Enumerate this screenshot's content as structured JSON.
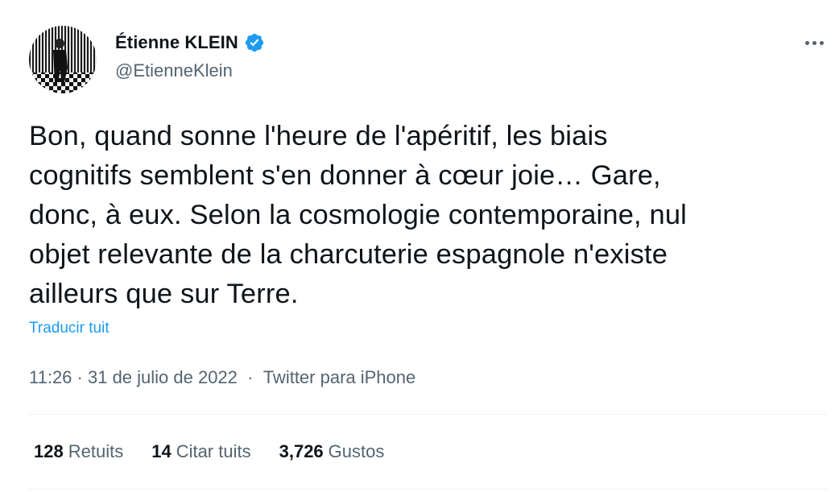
{
  "author": {
    "display_name": "Étienne KLEIN",
    "handle": "@EtienneKlein",
    "verified": true,
    "avatar_icon": "avatar-photo"
  },
  "more_icon": "more-horizontal-icon",
  "tweet": {
    "lines": [
      "Bon, quand sonne l'heure de l'apéritif, les biais",
      "cognitifs semblent s'en donner à cœur joie… Gare,",
      "donc, à eux. Selon la cosmologie contemporaine, nul",
      "objet relevante de la charcuterie espagnole n'existe",
      "ailleurs que sur Terre."
    ],
    "translate_label": "Traducir tuit"
  },
  "meta": {
    "time": "11:26",
    "separator1": " · ",
    "date": "31 de julio de 2022",
    "separator2": "  ·  ",
    "source": "Twitter para iPhone"
  },
  "stats": {
    "retweets": {
      "count": "128",
      "label": "Retuits"
    },
    "quotes": {
      "count": "14",
      "label": "Citar tuits"
    },
    "likes": {
      "count": "3,726",
      "label": "Gustos"
    }
  },
  "colors": {
    "accent": "#1d9bf0",
    "text_primary": "#0f1419",
    "text_secondary": "#536471",
    "divider": "#eff3f4"
  }
}
